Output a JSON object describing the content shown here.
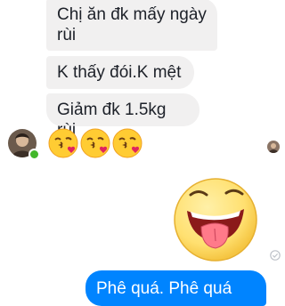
{
  "messages": {
    "incoming": [
      {
        "text": "Chị ăn đk mấy ngày rùi"
      },
      {
        "text": "K thấy đói.K mệt"
      },
      {
        "text": "Giảm đk 1.5kg rùi"
      }
    ],
    "outgoing_partial": "Phê quá. Phê quá"
  },
  "icons": {
    "emoji": "face-blowing-a-kiss-icon",
    "sticker": "tongue-out-face-sticker",
    "sent_status": "sent-check-icon"
  },
  "colors": {
    "incoming_bubble": "#f1f0f0",
    "outgoing_bubble": "#0084ff",
    "online": "#42b72a"
  }
}
